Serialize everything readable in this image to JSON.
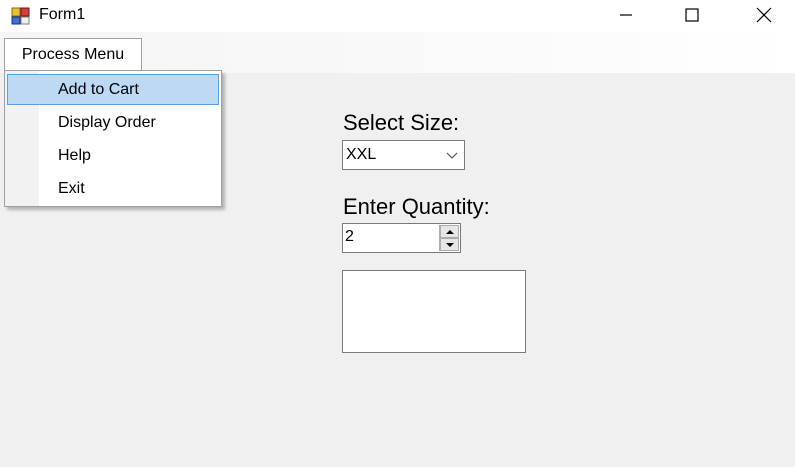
{
  "window": {
    "title": "Form1",
    "icons": {
      "app": "form-app-icon",
      "minimize": "minimize-icon",
      "maximize": "maximize-icon",
      "close": "close-icon"
    }
  },
  "menubar": {
    "process_menu": "Process Menu",
    "items": [
      {
        "label": "Add to Cart",
        "highlighted": true
      },
      {
        "label": "Display Order",
        "highlighted": false
      },
      {
        "label": "Help",
        "highlighted": false
      },
      {
        "label": "Exit",
        "highlighted": false
      }
    ]
  },
  "form": {
    "size_label": "Select Size:",
    "size_value": "XXL",
    "quantity_label": "Enter Quantity:",
    "quantity_value": "2",
    "output_text": ""
  },
  "colors": {
    "highlight_bg": "#bdd9f3",
    "highlight_border": "#5aa0e0",
    "form_bg": "#f0f0f0"
  }
}
